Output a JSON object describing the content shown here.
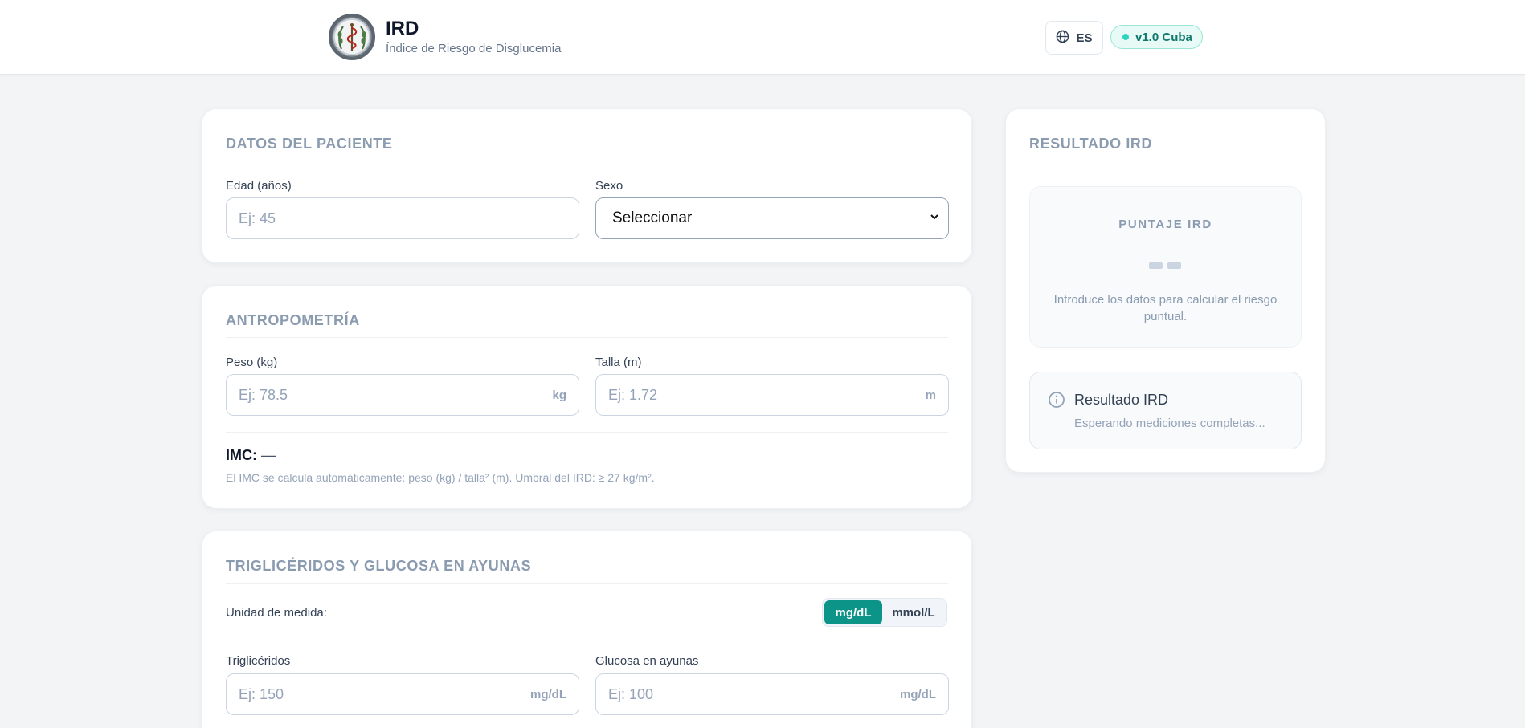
{
  "header": {
    "app_name": "IRD",
    "app_subtitle": "Índice de Riesgo de Disglucemia",
    "language": "ES",
    "version_badge": "v1.0 Cuba",
    "accent_color": "#0d9488"
  },
  "patient": {
    "title": "DATOS DEL PACIENTE",
    "age_label": "Edad (años)",
    "age_placeholder": "Ej: 45",
    "age_value": "",
    "sex_label": "Sexo",
    "sex_selected": "Seleccionar"
  },
  "anthropometry": {
    "title": "ANTROPOMETRÍA",
    "weight_label": "Peso (kg)",
    "weight_placeholder": "Ej: 78.5",
    "weight_value": "",
    "weight_unit": "kg",
    "height_label": "Talla (m)",
    "height_placeholder": "Ej: 1.72",
    "height_value": "",
    "height_unit": "m",
    "imc_label": "IMC:",
    "imc_value": "—",
    "imc_note": "El IMC se calcula automáticamente: peso (kg) / talla² (m). Umbral del IRD: ≥ 27 kg/m²."
  },
  "labs": {
    "title": "TRIGLICÉRIDOS Y GLUCOSA EN AYUNAS",
    "unit_label": "Unidad de medida:",
    "unit_options": [
      "mg/dL",
      "mmol/L"
    ],
    "unit_selected": "mg/dL",
    "tg_label": "Triglicéridos",
    "tg_placeholder": "Ej: 150",
    "tg_value": "",
    "tg_unit": "mg/dL",
    "glucose_label": "Glucosa en ayunas",
    "glucose_placeholder": "Ej: 100",
    "glucose_value": "",
    "glucose_unit": "mg/dL"
  },
  "result": {
    "title": "RESULTADO IRD",
    "score_title": "PUNTAJE IRD",
    "score_hint": "Introduce los datos para calcular el riesgo puntual.",
    "info_title": "Resultado IRD",
    "info_status": "Esperando mediciones completas..."
  }
}
